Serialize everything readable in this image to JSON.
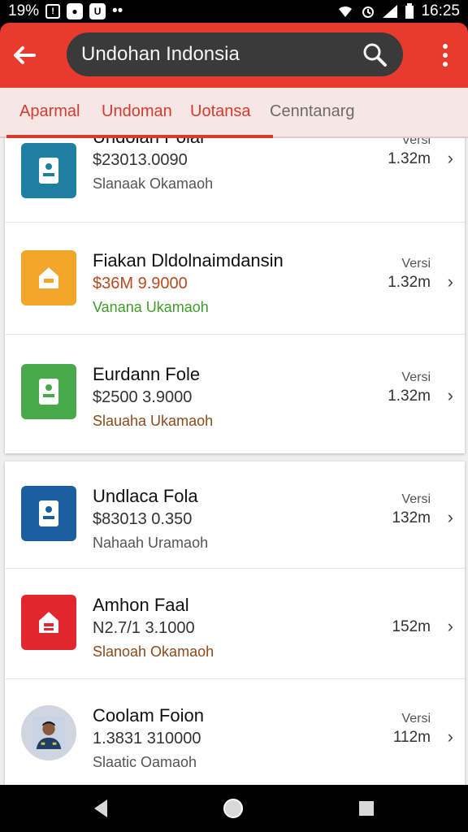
{
  "status_bar": {
    "battery_pct_text": "19%",
    "time": "16:25"
  },
  "app_bar": {
    "search_query": "Undohan Indonsia"
  },
  "tabs": [
    {
      "label": "Aparmal",
      "active": true
    },
    {
      "label": "Undoman",
      "active": true
    },
    {
      "label": "Uotansa",
      "active": true
    },
    {
      "label": "Cenntanarg",
      "active": false
    }
  ],
  "list_groups": [
    {
      "items": [
        {
          "title": "Undolan Polal",
          "price": "$23013.0090",
          "status": "Slanaak Okamaoh",
          "versi_label": "Versi",
          "size": "1.32m",
          "icon": "document-icon",
          "icon_color": "#1f7fa2"
        },
        {
          "title": "Fiakan Dldolnaimdansin",
          "price": "$36M 9.9000",
          "status": "Vanana Ukamaoh",
          "versi_label": "Versi",
          "size": "1.32m",
          "icon": "home-icon",
          "icon_color": "#f2a52b"
        },
        {
          "title": "Eurdann Fole",
          "price": "$2500 3.9000",
          "status": "Slauaha Ukamaoh",
          "versi_label": "Versi",
          "size": "1.32m",
          "icon": "document-icon",
          "icon_color": "#48a84a"
        }
      ]
    },
    {
      "items": [
        {
          "title": "Undlaca Fola",
          "price": "$83013 0.350",
          "status": "Nahaah Uramaoh",
          "versi_label": "Versi",
          "size": "132m",
          "icon": "document-icon",
          "icon_color": "#1c5fa0"
        },
        {
          "title": "Amhon Faal",
          "price": "N2.7/1 3.1000",
          "status": "Slanoah Okamaoh",
          "versi_label": "",
          "size": "152m",
          "icon": "home-icon",
          "icon_color": "#e2262e"
        },
        {
          "title": "Coolam Foion",
          "price": "1.3831 310000",
          "status": "Slaatic Oamaoh",
          "versi_label": "Versi",
          "size": "112m",
          "icon": "avatar-photo",
          "icon_color": ""
        }
      ]
    }
  ]
}
